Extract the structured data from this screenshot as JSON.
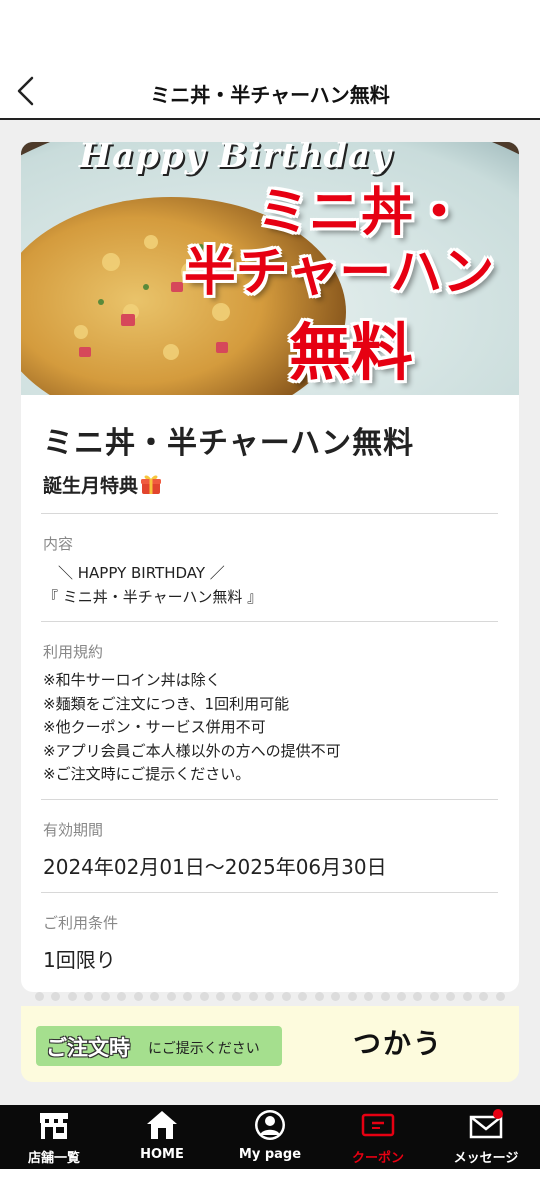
{
  "header": {
    "title": "ミニ丼・半チャーハン無料",
    "back_icon": "chevron-left-icon"
  },
  "hero": {
    "banner_text": "Happy Birthday",
    "headline_line1": "ミニ丼・",
    "headline_line2": "半チャーハン",
    "headline_line3": "無料",
    "headline_color": "#e60012"
  },
  "coupon": {
    "title": "ミニ丼・半チャーハン無料",
    "subtitle": "誕生月特典",
    "subtitle_icon": "gift-icon",
    "content_label": "内容",
    "content_line1": "　＼ HAPPY BIRTHDAY ／",
    "content_line2": "『 ミニ丼・半チャーハン無料 』",
    "terms_label": "利用規約",
    "terms": [
      "※和牛サーロイン丼は除く",
      "※麺類をご注文につき、1回利用可能",
      "※他クーポン・サービス併用不可",
      "※アプリ会員ご本人様以外の方への提供不可",
      "※ご注文時にご提示ください。"
    ],
    "period_label": "有効期間",
    "period_value": "2024年02月01日～2025年06月30日",
    "condition_label": "ご利用条件",
    "condition_value": "1回限り"
  },
  "stub": {
    "badge_strong": "ご注文時",
    "badge_rest": "にご提示ください",
    "use_button": "つかう"
  },
  "tabbar": {
    "tabs": [
      {
        "label": "店舗一覧",
        "icon": "store-icon"
      },
      {
        "label": "HOME",
        "icon": "home-icon"
      },
      {
        "label": "My page",
        "icon": "user-icon"
      },
      {
        "label": "クーポン",
        "icon": "coupon-icon",
        "active": true
      },
      {
        "label": "メッセージ",
        "icon": "mail-icon",
        "has_notification": true
      }
    ],
    "active_color": "#e60012"
  }
}
